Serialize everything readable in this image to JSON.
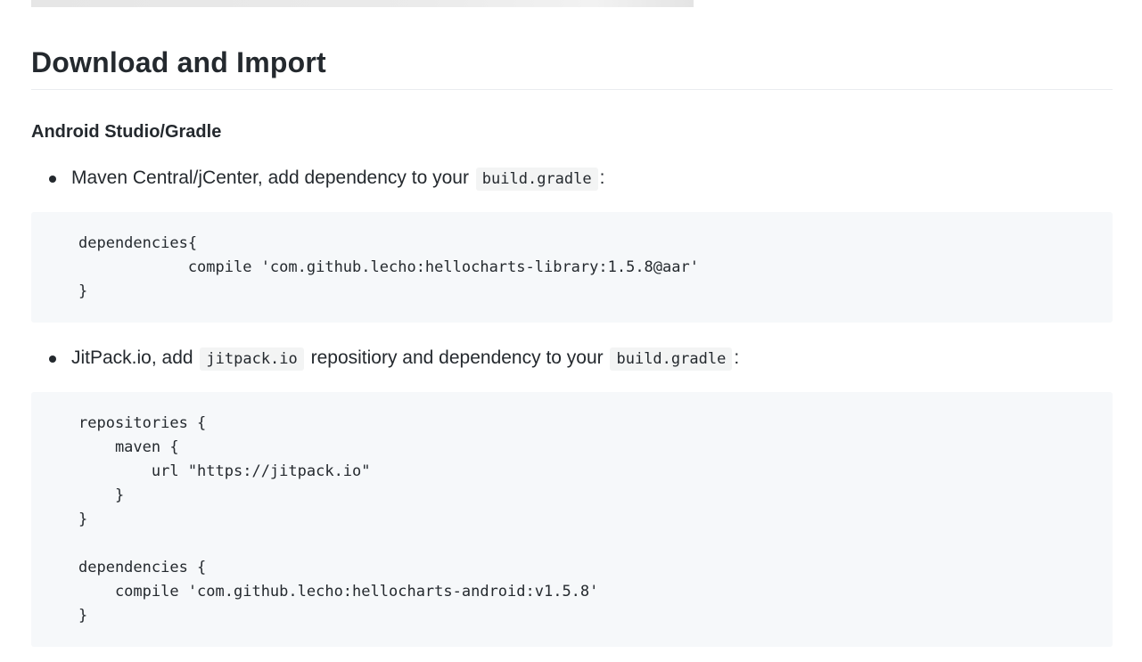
{
  "section": {
    "title": "Download and Import"
  },
  "subsection": {
    "title": "Android Studio/Gradle"
  },
  "bullets": [
    {
      "text_before": "Maven Central/jCenter, add dependency to your ",
      "code": "build.gradle",
      "text_after": ":"
    },
    {
      "text_before": "JitPack.io, add ",
      "code_1": "jitpack.io",
      "text_middle": " repositiory and dependency to your ",
      "code_2": "build.gradle",
      "text_after": ":"
    }
  ],
  "code_blocks": [
    {
      "lines": [
        "dependencies{",
        "            compile 'com.github.lecho:hellocharts-library:1.5.8@aar'",
        "}"
      ]
    },
    {
      "lines": [
        "repositories {",
        "    maven {",
        "        url \"https://jitpack.io\"",
        "    }",
        "}",
        "",
        "dependencies {",
        "    compile 'com.github.lecho:hellocharts-android:v1.5.8'",
        "}"
      ]
    }
  ]
}
